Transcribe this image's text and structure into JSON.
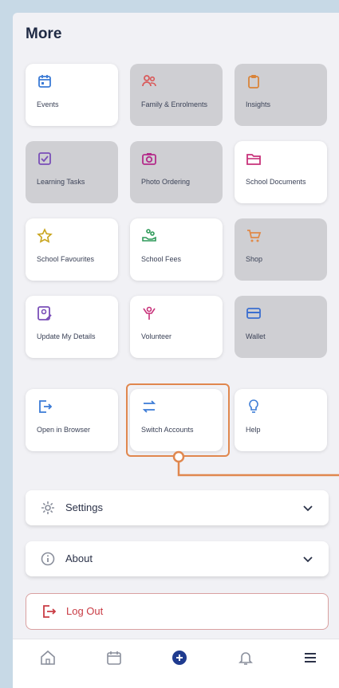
{
  "header": {
    "title": "More"
  },
  "tiles": [
    {
      "label": "Events",
      "icon": "calendar-icon",
      "color": "#3b7bd6"
    },
    {
      "label": "Family & Enrolments",
      "icon": "users-icon",
      "color": "#d95b5b"
    },
    {
      "label": "Insights",
      "icon": "clipboard-icon",
      "color": "#d9843a"
    },
    {
      "label": "Learning Tasks",
      "icon": "checkbox-icon",
      "color": "#7a4fb8"
    },
    {
      "label": "Photo Ordering",
      "icon": "camera-icon",
      "color": "#b42c8a"
    },
    {
      "label": "School Documents",
      "icon": "folder-icon",
      "color": "#c8327a"
    },
    {
      "label": "School Favourites",
      "icon": "star-icon",
      "color": "#c9a51e"
    },
    {
      "label": "School Fees",
      "icon": "money-hand-icon",
      "color": "#2f9a5a"
    },
    {
      "label": "Shop",
      "icon": "cart-icon",
      "color": "#e08a4a"
    },
    {
      "label": "Update My Details",
      "icon": "edit-profile-icon",
      "color": "#7a4fb8"
    },
    {
      "label": "Volunteer",
      "icon": "volunteer-icon",
      "color": "#c8327a"
    },
    {
      "label": "Wallet",
      "icon": "wallet-icon",
      "color": "#3b6fd0"
    },
    {
      "label": "Open in Browser",
      "icon": "open-external-icon",
      "color": "#3b7bd6"
    },
    {
      "label": "Switch Accounts",
      "icon": "switch-icon",
      "color": "#3b7bd6"
    },
    {
      "label": "Help",
      "icon": "lightbulb-icon",
      "color": "#3b7bd6"
    }
  ],
  "sections": {
    "settings": "Settings",
    "about": "About",
    "logout": "Log Out"
  },
  "colors": {
    "accent": "#1f3b8f",
    "highlight": "#e0874e",
    "danger": "#c93b44"
  },
  "tabbar": [
    "home-icon",
    "calendar-icon",
    "plus-circle-icon",
    "bell-icon",
    "menu-icon"
  ]
}
